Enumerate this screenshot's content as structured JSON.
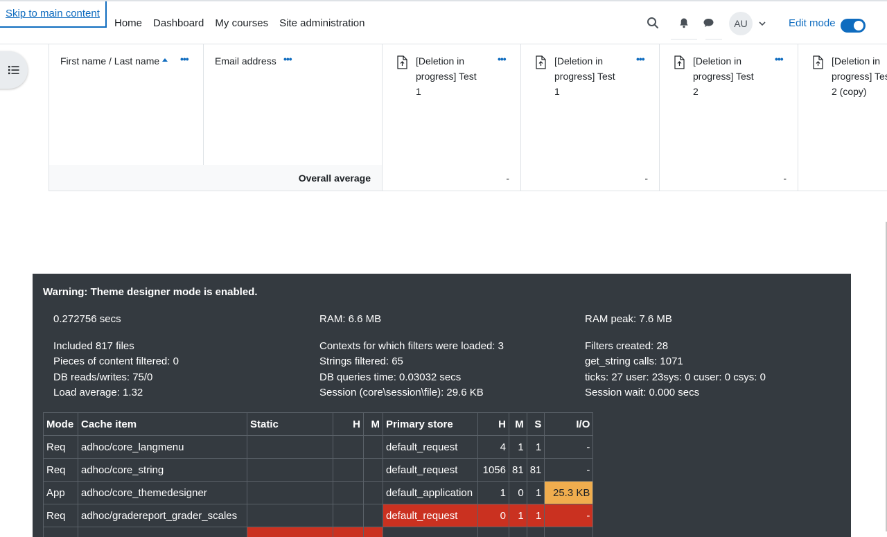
{
  "skip_link": "Skip to main content",
  "nav": {
    "items": [
      "Home",
      "Dashboard",
      "My courses",
      "Site administration"
    ]
  },
  "user": {
    "initials": "AU"
  },
  "edit_mode": {
    "label": "Edit mode",
    "enabled": true
  },
  "colors": {
    "accent": "#0f6cbf",
    "panel": "#343a40",
    "danger": "#ca3120",
    "warning": "#f0ad4e"
  },
  "grader": {
    "columns": [
      {
        "label": "First name / Last name"
      },
      {
        "label": "Email address"
      },
      {
        "lines": [
          "[Deletion in",
          "progress] Test",
          "1"
        ]
      },
      {
        "lines": [
          "[Deletion in",
          "progress] Test",
          "1"
        ]
      },
      {
        "lines": [
          "[Deletion in",
          "progress] Test",
          "2"
        ]
      },
      {
        "lines": [
          "[Deletion in",
          "progress] Test",
          "2 (copy)"
        ]
      }
    ],
    "overall_label": "Overall average",
    "overall_values": [
      "-",
      "-",
      "-"
    ]
  },
  "perf": {
    "warning": "Warning: Theme designer mode is enabled.",
    "stats": {
      "time": "0.272756 secs",
      "ram": "RAM: 6.6 MB",
      "ram_peak": "RAM peak: 7.6 MB",
      "included": "Included 817 files",
      "contexts": "Contexts for which filters were loaded: 3",
      "filters_created": "Filters created: 28",
      "pieces": "Pieces of content filtered: 0",
      "strings": "Strings filtered: 65",
      "get_string": "get_string calls: 1071",
      "db_rw": "DB reads/writes: 75/0",
      "db_time": "DB queries time: 0.03032 secs",
      "ticks": "ticks: 27 user: 23sys: 0 cuser: 0 csys: 0",
      "load": "Load average: 1.32",
      "session": "Session (core\\session\\file): 29.6 KB",
      "session_wait": "Session wait: 0.000 secs"
    },
    "cache_headers": [
      "Mode",
      "Cache item",
      "Static",
      "H",
      "M",
      "Primary store",
      "H",
      "M",
      "S",
      "I/O"
    ],
    "cache_rows": [
      {
        "mode": "Req",
        "item": "adhoc/core_langmenu",
        "store": "default_request",
        "h": "4",
        "m": "1",
        "s": "1",
        "io": "-",
        "store_status": "",
        "io_status": ""
      },
      {
        "mode": "Req",
        "item": "adhoc/core_string",
        "store": "default_request",
        "h": "1056",
        "m": "81",
        "s": "81",
        "io": "-",
        "store_status": "",
        "io_status": ""
      },
      {
        "mode": "App",
        "item": "adhoc/core_themedesigner",
        "store": "default_application",
        "h": "1",
        "m": "0",
        "s": "1",
        "io": "25.3 KB",
        "store_status": "",
        "io_status": "orange"
      },
      {
        "mode": "Req",
        "item": "adhoc/gradereport_grader_scales",
        "store": "default_request",
        "h": "0",
        "m": "1",
        "s": "1",
        "io": "-",
        "store_status": "red",
        "io_status": "red"
      }
    ]
  }
}
